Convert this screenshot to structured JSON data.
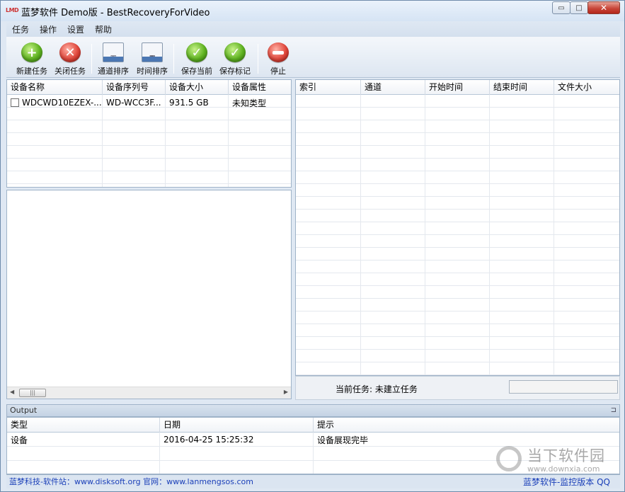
{
  "window": {
    "logo_text": "LMD",
    "title": "蓝梦软件 Demo版 - BestRecoveryForVideo",
    "minimize_label": "▭",
    "maximize_label": "□",
    "close_label": "✕"
  },
  "menu": [
    "任务",
    "操作",
    "设置",
    "帮助"
  ],
  "toolbar": [
    {
      "label": "新建任务",
      "icon": "add-icon"
    },
    {
      "label": "关闭任务",
      "icon": "close-task-icon"
    },
    {
      "label": "通道排序",
      "icon": "calendar-person-icon"
    },
    {
      "label": "时间排序",
      "icon": "calendar-icon"
    },
    {
      "label": "保存当前",
      "icon": "check-icon"
    },
    {
      "label": "保存标记",
      "icon": "check-icon"
    },
    {
      "label": "停止",
      "icon": "stop-icon"
    }
  ],
  "device_table": {
    "columns": [
      "设备名称",
      "设备序列号",
      "设备大小",
      "设备属性"
    ],
    "rows": [
      {
        "name": "WDCWD10EZEX-...",
        "serial": "WD-WCC3F...",
        "size": "931.5 GB",
        "attr": "未知类型"
      }
    ]
  },
  "file_table": {
    "columns": [
      "索引",
      "通道",
      "开始时间",
      "结束时间",
      "文件大小"
    ]
  },
  "status": {
    "current_task": "当前任务: 未建立任务"
  },
  "output": {
    "title": "Output",
    "pin": "⊐",
    "columns": [
      "类型",
      "日期",
      "提示"
    ],
    "rows": [
      {
        "type": "设备",
        "date": "2016-04-25 15:25:32",
        "hint": "设备展现完毕"
      }
    ]
  },
  "footer": {
    "left": "蓝梦科技-软件站：www.disksoft.org  官网：www.lanmengsos.com",
    "right": "蓝梦软件-监控版本 QQ"
  },
  "watermark": {
    "title": "当下软件园",
    "url": "www.downxia.com"
  },
  "colors": {
    "accent": "#1a3fb8",
    "window_bg": "#dfe8f3"
  }
}
